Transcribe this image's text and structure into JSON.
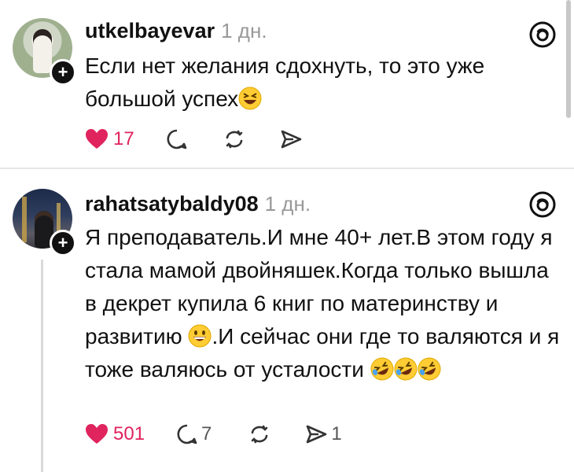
{
  "posts": [
    {
      "username": "utkelbayevar",
      "time": "1 дн.",
      "text_before_emoji": "Если нет желания сдохнуть, то это уже большой успех",
      "emoji": [
        "laughing-face"
      ],
      "likes": "17",
      "liked": true,
      "comments": "",
      "reposts": "",
      "shares": ""
    },
    {
      "username": "rahatsatybaldy08",
      "time": "1 дн.",
      "text_part1": "Я преподаватель.И мне 40+ лет.В этом году я стала мамой двойняшек.Когда только вышла в декрет купила 6 книг по материнству и развитию ",
      "text_part2": ".И сейчас они где то валяются и я тоже валяюсь от усталости ",
      "emoji": [
        "grinning-face",
        "rolling-on-floor-laughing",
        "rolling-on-floor-laughing",
        "rolling-on-floor-laughing"
      ],
      "likes": "501",
      "liked": true,
      "comments": "7",
      "reposts": "",
      "shares": "1"
    }
  ],
  "colors": {
    "like": "#e0245e",
    "muted": "#999999",
    "divider": "#e6e6e6"
  }
}
